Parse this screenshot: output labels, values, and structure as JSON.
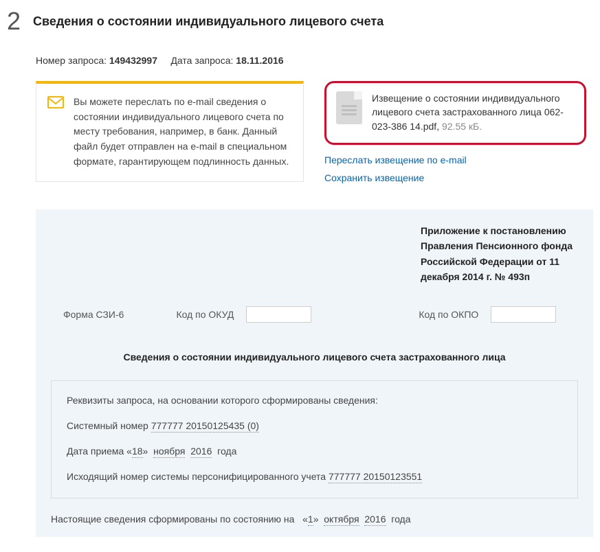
{
  "step": {
    "number": "2",
    "title": "Сведения о состоянии индивидуального лицевого счета"
  },
  "meta": {
    "reqnum_label": "Номер запроса:",
    "reqnum_value": "149432997",
    "reqdate_label": "Дата запроса:",
    "reqdate_value": "18.11.2016"
  },
  "info": "Вы можете переслать по e-mail сведения о состоянии индивидуального лицевого счета по месту требования, например, в банк. Данный файл будет отправлен на e-mail в специальном формате, гарантирующем подлинность данных.",
  "file": {
    "name": "Извещение о состоянии индивидуального лицевого счета застрахованного лица 062-023-386 14.pdf",
    "size": "92.55 кБ."
  },
  "links": {
    "forward": "Переслать извещение по e-mail",
    "save": "Сохранить извещение"
  },
  "annex": "Приложение к постановлению Правления Пенсионного фонда Российской Федерации от 11 декабря 2014 г. № 493п",
  "codes": {
    "form_label": "Форма СЗИ-6",
    "okud_label": "Код по ОКУД",
    "okpo_label": "Код по ОКПО"
  },
  "doc_title": "Сведения о состоянии индивидуального лицевого счета застрахованного лица",
  "req": {
    "heading": "Реквизиты запроса, на основании которого сформированы сведения:",
    "sysnum_label": "Системный номер",
    "sysnum_value": "777777 20150125435 (0)",
    "accept_prefix": "Дата приема «",
    "accept_day": "18",
    "accept_mid": "»",
    "accept_month": "ноября",
    "accept_year": "2016",
    "accept_suffix": "года",
    "outnum_label": "Исходящий номер системы персонифицированного учета",
    "outnum_value": "777777 20150123551"
  },
  "state": {
    "prefix": "Настоящие сведения сформированы по состоянию на",
    "q1": "«",
    "day": "1",
    "q2": "»",
    "month": "октября",
    "year": "2016",
    "suffix": "года"
  }
}
